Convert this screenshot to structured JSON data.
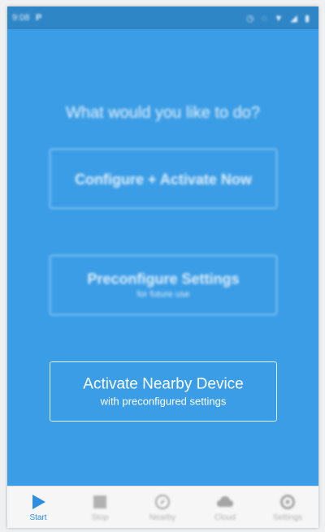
{
  "status_bar": {
    "time": "9:08",
    "notification": "P",
    "icons": [
      "alarm-icon",
      "circle-icon",
      "wifi-icon",
      "signal-icon",
      "battery-icon"
    ]
  },
  "main": {
    "question": "What would you like to do?",
    "options": [
      {
        "title": "Configure + Activate Now",
        "subtitle": ""
      },
      {
        "title": "Preconfigure Settings",
        "subtitle": "for future use"
      },
      {
        "title": "Activate Nearby Device",
        "subtitle": "with preconfigured settings"
      }
    ]
  },
  "bottom_nav": {
    "items": [
      {
        "label": "Start",
        "icon": "play-icon",
        "active": true
      },
      {
        "label": "Stop",
        "icon": "stop-icon",
        "active": false
      },
      {
        "label": "Nearby",
        "icon": "compass-icon",
        "active": false
      },
      {
        "label": "Cloud",
        "icon": "cloud-icon",
        "active": false
      },
      {
        "label": "Settings",
        "icon": "gear-icon",
        "active": false
      }
    ]
  },
  "colors": {
    "background": "#3a9de6",
    "status_bar": "#2f86c6",
    "accent": "#2f8ee0",
    "nav_background": "#f6f6f6"
  }
}
